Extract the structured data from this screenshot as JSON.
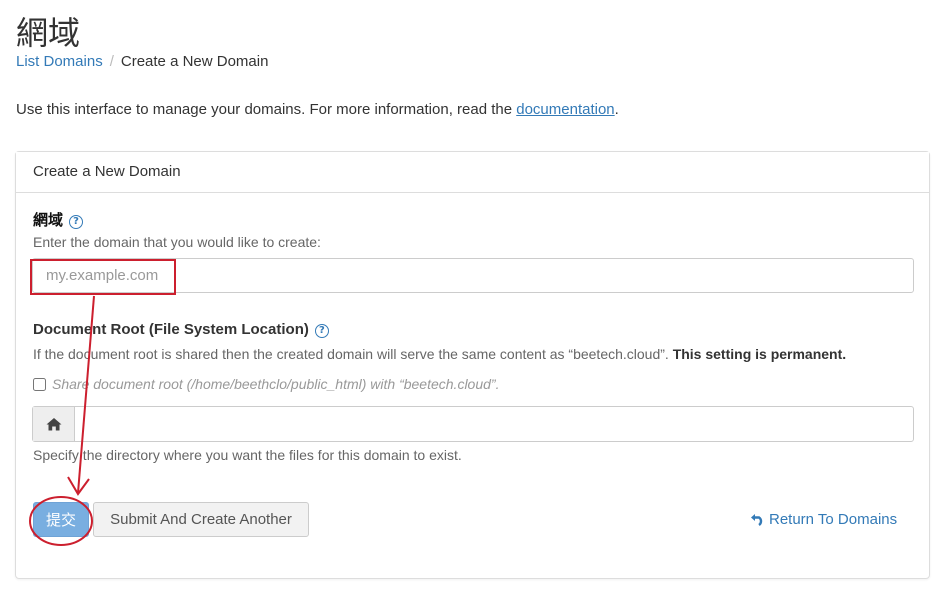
{
  "page": {
    "title": "網域",
    "breadcrumb": {
      "link": "List Domains",
      "current": "Create a New Domain"
    },
    "intro": {
      "text": "Use this interface to manage your domains. For more information, read the ",
      "link": "documentation",
      "end": "."
    }
  },
  "panel": {
    "heading": "Create a New Domain",
    "domain": {
      "label": "網域",
      "help": "?",
      "hint": "Enter the domain that you would like to create:",
      "placeholder": "my.example.com",
      "value": ""
    },
    "docroot": {
      "label": "Document Root (File System Location)",
      "help": "?",
      "hint": "If the document root is shared then the created domain will serve the same content as “beetech.cloud”. ",
      "hint_bold": "This setting is permanent.",
      "share_label": "Share document root (/home/beethclo/public_html) with “beetech.cloud”.",
      "share_checked": false,
      "home_icon": "home-icon",
      "value": "",
      "dir_hint": "Specify the directory where you want the files for this domain to exist."
    },
    "actions": {
      "submit": "提交",
      "submit_another": "Submit And Create Another",
      "return": "Return To Domains",
      "return_icon": "undo-arrow-icon"
    }
  },
  "colors": {
    "link": "#337ab7",
    "primary_button": "#79aee0",
    "annotation": "#cc1f2e"
  }
}
